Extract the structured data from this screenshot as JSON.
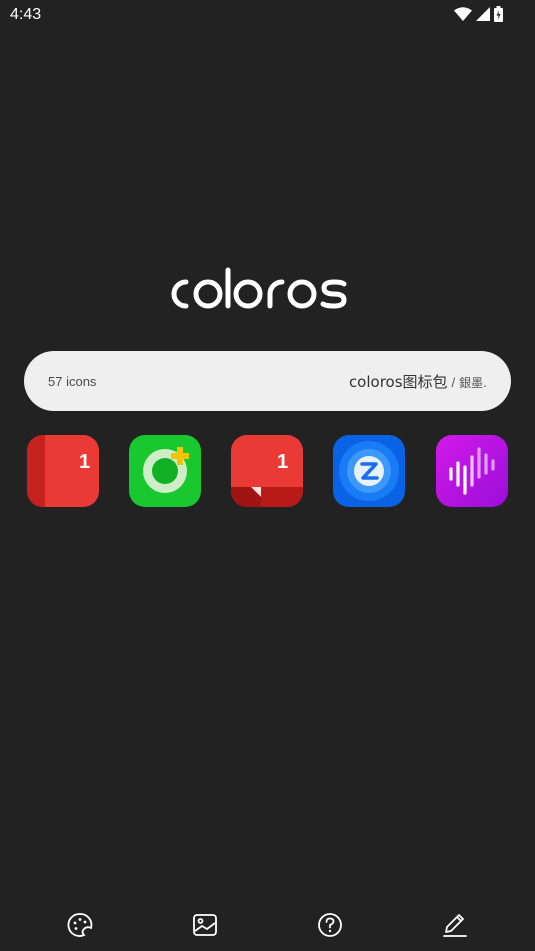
{
  "status_bar": {
    "time": "4:43",
    "icons": [
      "wifi-icon",
      "signal-icon",
      "battery-charging-icon"
    ]
  },
  "logo": {
    "text": "coloros"
  },
  "info": {
    "icon_count": "57 icons",
    "pack_name": "coloros图标包",
    "separator": "/",
    "author": "銀墨."
  },
  "preview_icons": [
    {
      "name": "calendar-app-icon",
      "badge": "1",
      "color": "#e8312f"
    },
    {
      "name": "camera-app-icon",
      "color": "#19c72e"
    },
    {
      "name": "messages-app-icon",
      "badge": "1",
      "color": "#e8312f"
    },
    {
      "name": "z-app-icon",
      "color": "#1a7cf5"
    },
    {
      "name": "voice-recorder-app-icon",
      "color": "#b313e6"
    }
  ],
  "bottom_nav": {
    "items": [
      "palette-icon",
      "wallpaper-icon",
      "help-icon",
      "edit-icon"
    ]
  },
  "colors": {
    "background": "#222222",
    "pill": "#efefef"
  }
}
